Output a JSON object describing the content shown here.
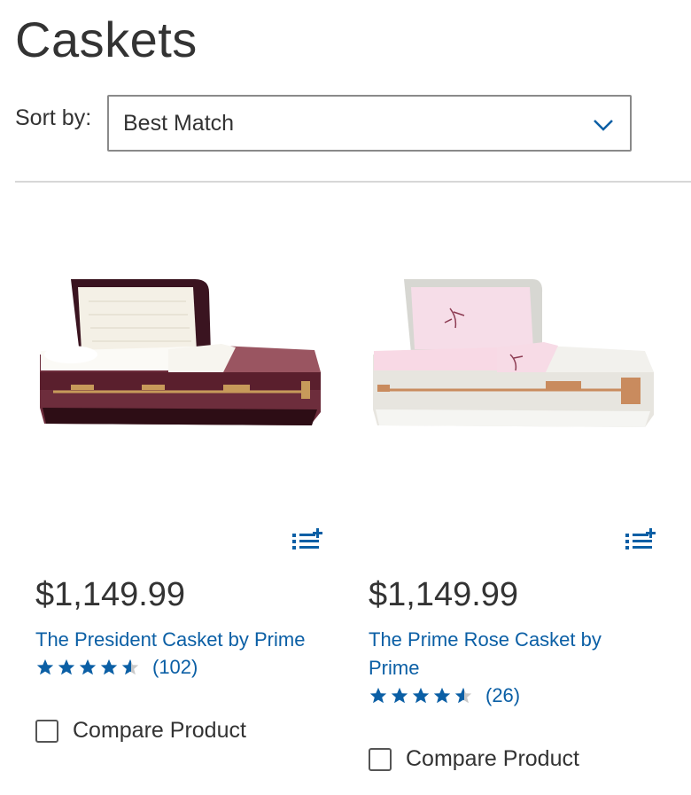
{
  "page": {
    "title": "Caskets"
  },
  "sort": {
    "label": "Sort by:",
    "selected": "Best Match"
  },
  "products": [
    {
      "price": "$1,149.99",
      "title": "The President Casket by Prime",
      "rating": 4.5,
      "review_count": "(102)",
      "compare_label": "Compare Product",
      "image": "burgundy-casket-image"
    },
    {
      "price": "$1,149.99",
      "title": "The Prime Rose Casket by Prime",
      "rating": 4.5,
      "review_count": "(26)",
      "compare_label": "Compare Product",
      "image": "pink-rose-casket-image"
    }
  ],
  "colors": {
    "link": "#0b5fa5",
    "star": "#0b5fa5",
    "text": "#333333"
  }
}
